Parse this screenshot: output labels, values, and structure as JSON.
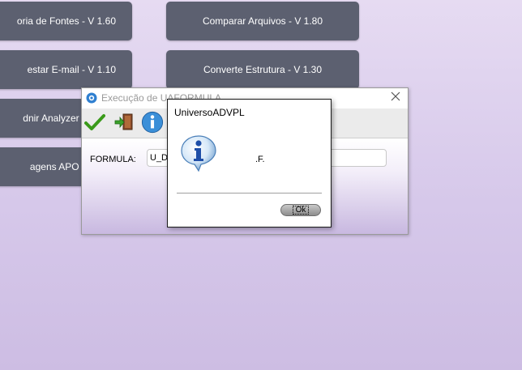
{
  "background_buttons": {
    "left": [
      "oria de Fontes - V 1.60",
      "estar E-mail - V 1.10",
      "dnir Analyzer - V 1.00",
      "agens APO - V 1.00"
    ],
    "right": [
      "Comparar Arquivos - V 1.80",
      "Converte Estrutura - V 1.30"
    ]
  },
  "main_dialog": {
    "title": "Execução de UAFORMULA",
    "toolbar": {
      "icons": [
        "confirm-check-icon",
        "exit-door-icon",
        "info-icon"
      ]
    },
    "formula_label": "FORMULA:",
    "formula_value": "U_De"
  },
  "message_box": {
    "title": "UniversoADVPL",
    "message": ".F.",
    "ok_label": "Ok",
    "icon": "info-icon"
  },
  "colors": {
    "button_bg": "#5c6070",
    "background_top": "#e6dbf2",
    "background_bottom": "#cdbde3",
    "check_green": "#3a9a1a"
  }
}
